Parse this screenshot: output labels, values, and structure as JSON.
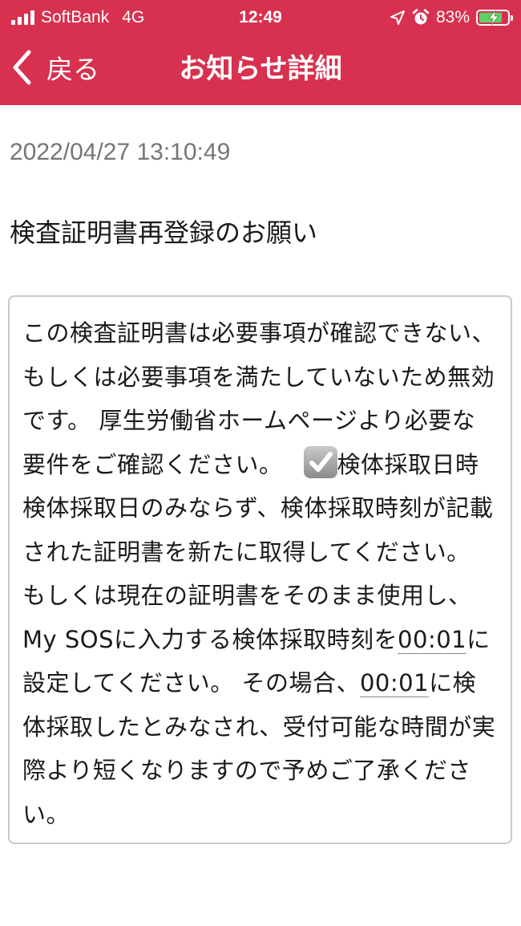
{
  "status_bar": {
    "carrier": "SoftBank",
    "network": "4G",
    "time": "12:49",
    "battery_percent": "83%",
    "battery_level": 0.83,
    "battery_color": "#5fd26a"
  },
  "nav": {
    "back_label": "戻る",
    "title": "お知らせ詳細",
    "bar_color": "#d7314f"
  },
  "notice": {
    "datetime": "2022/04/27 13:10:49",
    "subject": "検査証明書再登録のお願い",
    "body": {
      "part1": "この検査証明書は必要事項が確認できない、もしくは必要事項を満たしていないため無効です。 厚生労働省ホームページより必要な要件をご確認ください。",
      "check_icon": "heavy-check-mark-icon",
      "part2": "検体採取日時 検体採取日のみならず、検体採取時刻が記載された証明書を新たに取得してください。 もしくは現在の証明書をそのまま使用し、My SOSに入力する検体採取時刻を",
      "time1": "00:01",
      "part3": "に設定してください。 その場合、",
      "time2": "00:01",
      "part4": "に検体採取したとみなされ、受付可能な時間が実際より短くなりますので予めご了承ください。"
    }
  }
}
